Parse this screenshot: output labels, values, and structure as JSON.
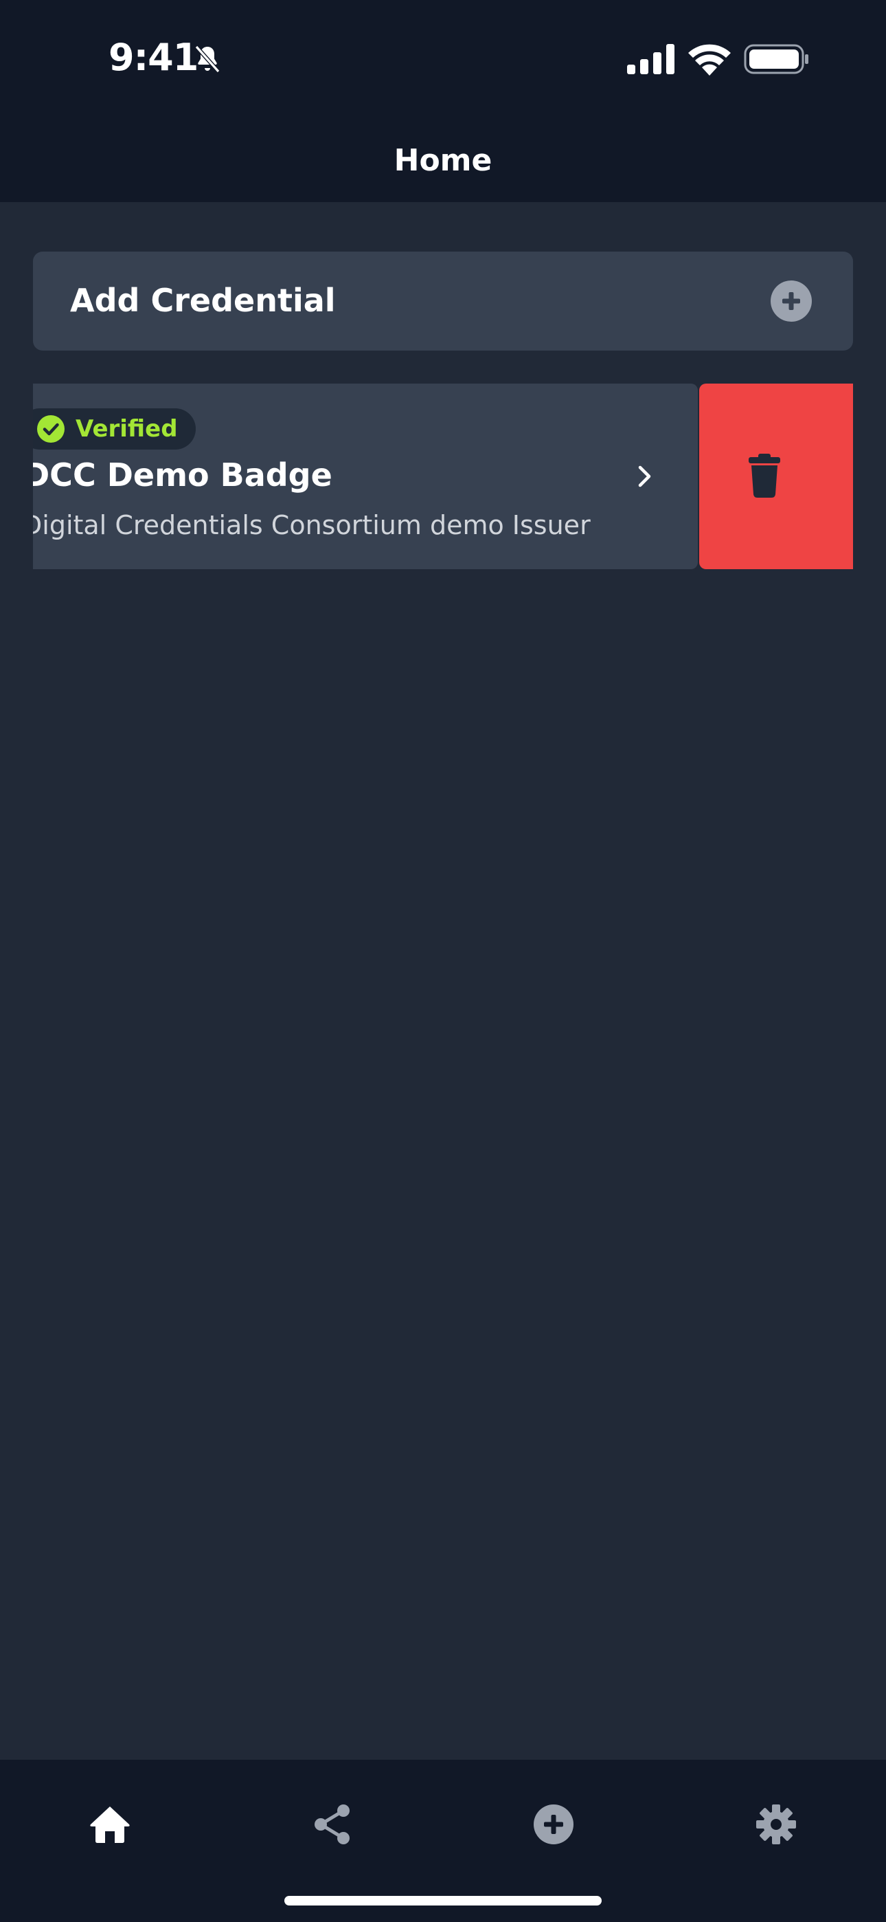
{
  "status_bar": {
    "time": "9:41"
  },
  "header": {
    "title": "Home"
  },
  "add_credential": {
    "label": "Add Credential"
  },
  "credentials": [
    {
      "status": "Verified",
      "title": "DCC Demo Badge",
      "issuer": "Digital Credentials Consortium demo Issuer"
    }
  ],
  "colors": {
    "verified": "#a3e635",
    "delete": "#ef4444",
    "background": "#212937",
    "card": "#374151",
    "bar": "#111827"
  },
  "tabs": [
    {
      "icon": "home-icon",
      "active": true
    },
    {
      "icon": "share-icon",
      "active": false
    },
    {
      "icon": "add-circle-icon",
      "active": false
    },
    {
      "icon": "gear-icon",
      "active": false
    }
  ]
}
